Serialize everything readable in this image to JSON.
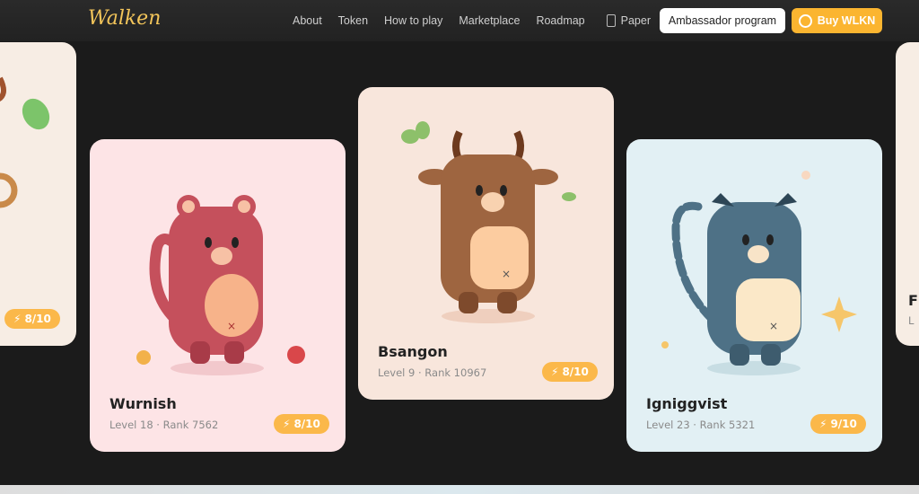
{
  "nav": {
    "logo": "Walken",
    "links": [
      "About",
      "Token",
      "How to play",
      "Marketplace",
      "Roadmap"
    ],
    "paper": "Paper",
    "ambassador": "Ambassador program",
    "buy": "Buy WLKN"
  },
  "cards": [
    {
      "name": "",
      "level": "",
      "rank": "",
      "energy": "8/10",
      "bg": "#f7ede4"
    },
    {
      "name": "Wurnish",
      "level": "Level 18",
      "rank": "Rank 7562",
      "energy": "8/10",
      "bg": "#fde4e6",
      "color": "#c5505c"
    },
    {
      "name": "Bsangon",
      "level": "Level 9",
      "rank": "Rank 10967",
      "energy": "8/10",
      "bg": "#f8e6dc",
      "color": "#9e6540"
    },
    {
      "name": "Igniggvist",
      "level": "Level 23",
      "rank": "Rank 5321",
      "energy": "9/10",
      "bg": "#e2f0f4",
      "color": "#4e7186"
    },
    {
      "name": "F",
      "level": "L",
      "bg": "#f7ede4"
    }
  ],
  "accent": "#fbb530"
}
